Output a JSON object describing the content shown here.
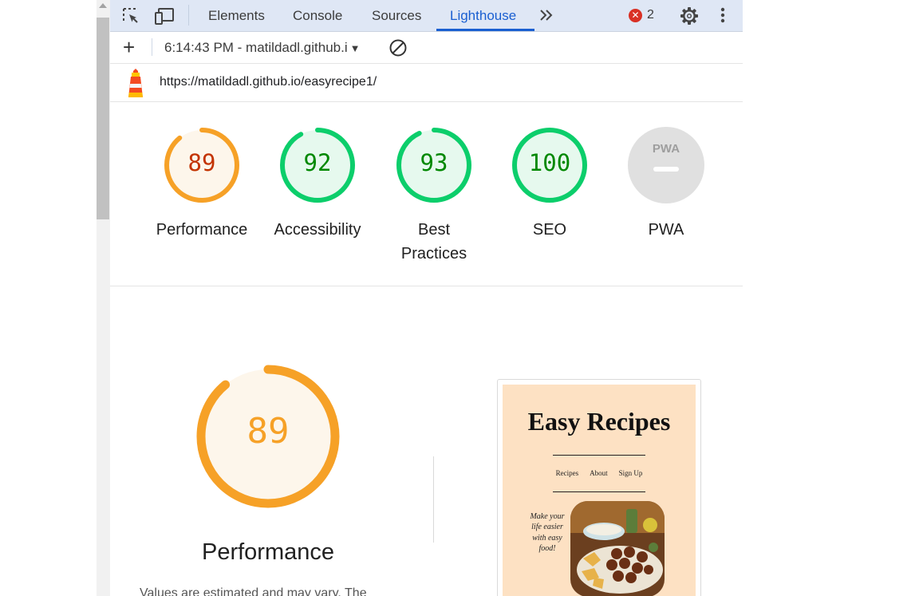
{
  "tabs": [
    {
      "label": "Elements"
    },
    {
      "label": "Console"
    },
    {
      "label": "Sources"
    },
    {
      "label": "Lighthouse",
      "active": true
    }
  ],
  "errors": {
    "count": "2"
  },
  "toolbar": {
    "report_label": "6:14:43 PM - matildadl.github.i"
  },
  "report": {
    "url": "https://matildadl.github.io/easyrecipe1/"
  },
  "gauges": [
    {
      "score": "89",
      "label": "Performance",
      "value": 89,
      "color": "#f6a127",
      "fill": "#fdf6eb",
      "text": "#c33300"
    },
    {
      "score": "92",
      "label": "Accessibility",
      "value": 92,
      "color": "#0cce6b",
      "fill": "#e6f9ee",
      "text": "#008800"
    },
    {
      "score": "93",
      "label": "Best Practices",
      "value": 93,
      "color": "#0cce6b",
      "fill": "#e6f9ee",
      "text": "#008800"
    },
    {
      "score": "100",
      "label": "SEO",
      "value": 100,
      "color": "#0cce6b",
      "fill": "#e6f9ee",
      "text": "#008800"
    }
  ],
  "pwa": {
    "label": "PWA",
    "badge": "PWA"
  },
  "performance": {
    "score": "89",
    "value": 89,
    "title": "Performance",
    "description": "Values are estimated and may vary. The"
  },
  "screenshot": {
    "title": "Easy Recipes",
    "nav": [
      "Recipes",
      "About",
      "Sign Up"
    ],
    "tagline": "Make your life easier with easy food!"
  },
  "icons": [
    "inspect-icon",
    "device-toolbar-icon",
    "more-tabs-icon",
    "error-icon",
    "settings-gear-icon",
    "kebab-menu-icon",
    "plus-icon",
    "dropdown-arrow-icon",
    "clear-icon",
    "lighthouse-logo-icon"
  ]
}
